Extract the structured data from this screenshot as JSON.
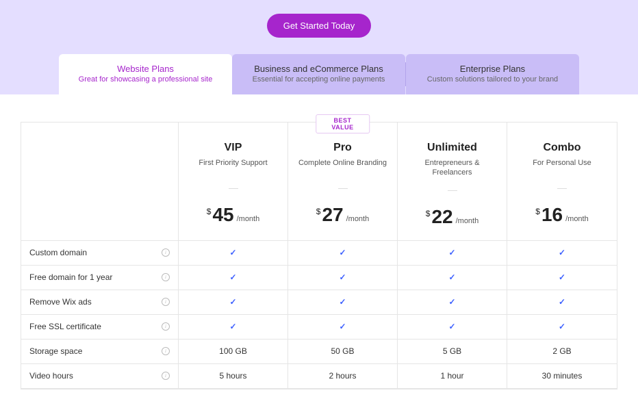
{
  "cta_label": "Get Started Today",
  "tabs": [
    {
      "title": "Website Plans",
      "sub": "Great for showcasing a professional site"
    },
    {
      "title": "Business and eCommerce Plans",
      "sub": "Essential for accepting online payments"
    },
    {
      "title": "Enterprise Plans",
      "sub": "Custom solutions tailored to your brand"
    }
  ],
  "best_value_label": "BEST VALUE",
  "currency": "$",
  "period": "/month",
  "plans": [
    {
      "name": "VIP",
      "sub": "First Priority Support",
      "price": "45"
    },
    {
      "name": "Pro",
      "sub": "Complete Online Branding",
      "price": "27",
      "best": true
    },
    {
      "name": "Unlimited",
      "sub": "Entrepreneurs & Freelancers",
      "price": "22"
    },
    {
      "name": "Combo",
      "sub": "For Personal Use",
      "price": "16"
    }
  ],
  "features": [
    {
      "label": "Custom domain",
      "values": [
        "check",
        "check",
        "check",
        "check"
      ]
    },
    {
      "label": "Free domain for 1 year",
      "values": [
        "check",
        "check",
        "check",
        "check"
      ]
    },
    {
      "label": "Remove Wix ads",
      "values": [
        "check",
        "check",
        "check",
        "check"
      ]
    },
    {
      "label": "Free SSL certificate",
      "values": [
        "check",
        "check",
        "check",
        "check"
      ]
    },
    {
      "label": "Storage space",
      "values": [
        "100 GB",
        "50 GB",
        "5 GB",
        "2 GB"
      ]
    },
    {
      "label": "Video hours",
      "values": [
        "5 hours",
        "2 hours",
        "1 hour",
        "30 minutes"
      ]
    }
  ],
  "chart_data": {
    "type": "table",
    "title": "Website Plans pricing comparison",
    "columns": [
      "VIP",
      "Pro",
      "Unlimited",
      "Combo"
    ],
    "price_per_month_usd": [
      45,
      27,
      22,
      16
    ],
    "rows": [
      {
        "feature": "Custom domain",
        "values": [
          true,
          true,
          true,
          true
        ]
      },
      {
        "feature": "Free domain for 1 year",
        "values": [
          true,
          true,
          true,
          true
        ]
      },
      {
        "feature": "Remove Wix ads",
        "values": [
          true,
          true,
          true,
          true
        ]
      },
      {
        "feature": "Free SSL certificate",
        "values": [
          true,
          true,
          true,
          true
        ]
      },
      {
        "feature": "Storage space",
        "values": [
          "100 GB",
          "50 GB",
          "5 GB",
          "2 GB"
        ]
      },
      {
        "feature": "Video hours",
        "values": [
          "5 hours",
          "2 hours",
          "1 hour",
          "30 minutes"
        ]
      }
    ],
    "best_value_column": "Pro"
  }
}
